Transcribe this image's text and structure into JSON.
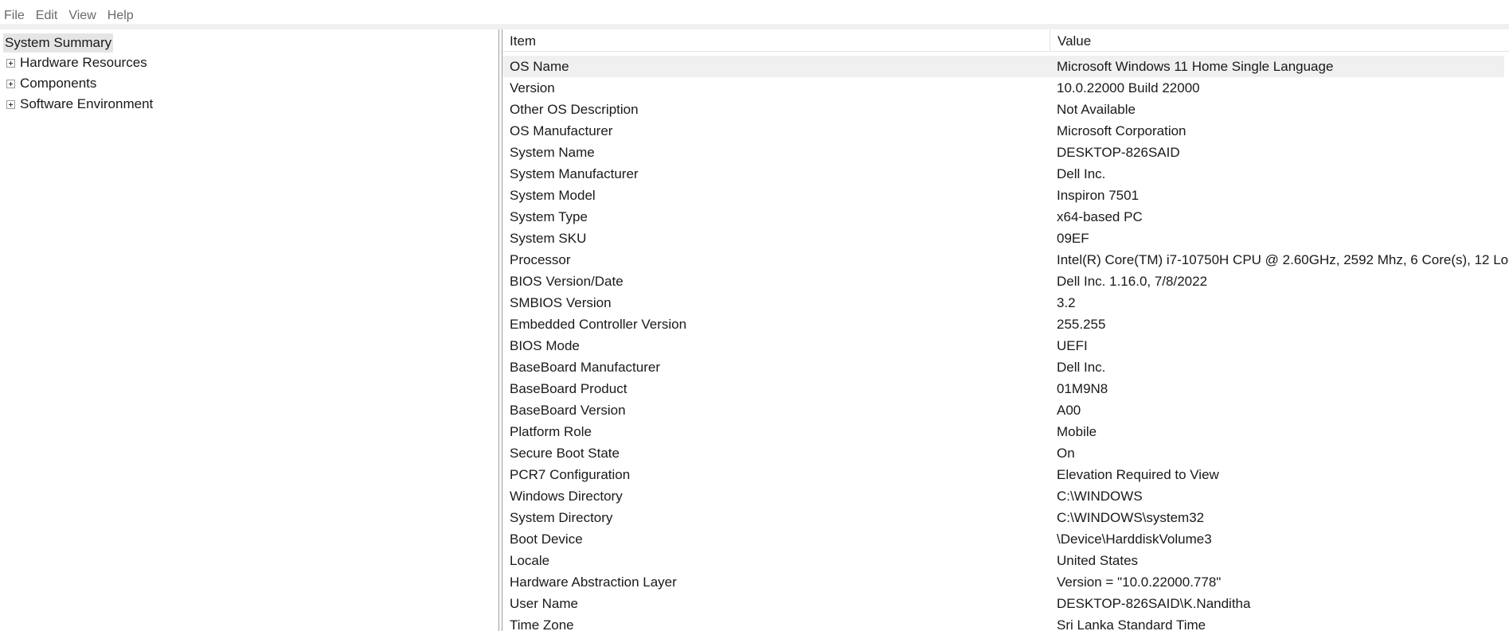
{
  "menu": [
    "File",
    "Edit",
    "View",
    "Help"
  ],
  "tree": {
    "root": "System Summary",
    "nodes": [
      "Hardware Resources",
      "Components",
      "Software Environment"
    ]
  },
  "table": {
    "columns": [
      "Item",
      "Value"
    ],
    "rows": [
      {
        "item": "OS Name",
        "value": "Microsoft Windows 11 Home Single Language"
      },
      {
        "item": "Version",
        "value": "10.0.22000 Build 22000"
      },
      {
        "item": "Other OS Description",
        "value": "Not Available"
      },
      {
        "item": "OS Manufacturer",
        "value": "Microsoft Corporation"
      },
      {
        "item": "System Name",
        "value": "DESKTOP-826SAID"
      },
      {
        "item": "System Manufacturer",
        "value": "Dell Inc."
      },
      {
        "item": "System Model",
        "value": "Inspiron 7501"
      },
      {
        "item": "System Type",
        "value": "x64-based PC"
      },
      {
        "item": "System SKU",
        "value": "09EF"
      },
      {
        "item": "Processor",
        "value": "Intel(R) Core(TM) i7-10750H CPU @ 2.60GHz, 2592 Mhz, 6 Core(s), 12 Logi"
      },
      {
        "item": "BIOS Version/Date",
        "value": "Dell Inc. 1.16.0, 7/8/2022"
      },
      {
        "item": "SMBIOS Version",
        "value": "3.2"
      },
      {
        "item": "Embedded Controller Version",
        "value": "255.255"
      },
      {
        "item": "BIOS Mode",
        "value": "UEFI"
      },
      {
        "item": "BaseBoard Manufacturer",
        "value": "Dell Inc."
      },
      {
        "item": "BaseBoard Product",
        "value": "01M9N8"
      },
      {
        "item": "BaseBoard Version",
        "value": "A00"
      },
      {
        "item": "Platform Role",
        "value": "Mobile"
      },
      {
        "item": "Secure Boot State",
        "value": "On"
      },
      {
        "item": "PCR7 Configuration",
        "value": "Elevation Required to View"
      },
      {
        "item": "Windows Directory",
        "value": "C:\\WINDOWS"
      },
      {
        "item": "System Directory",
        "value": "C:\\WINDOWS\\system32"
      },
      {
        "item": "Boot Device",
        "value": "\\Device\\HarddiskVolume3"
      },
      {
        "item": "Locale",
        "value": "United States"
      },
      {
        "item": "Hardware Abstraction Layer",
        "value": "Version = \"10.0.22000.778\""
      },
      {
        "item": "User Name",
        "value": "DESKTOP-826SAID\\K.Nanditha"
      },
      {
        "item": "Time Zone",
        "value": "Sri Lanka Standard Time"
      }
    ]
  }
}
